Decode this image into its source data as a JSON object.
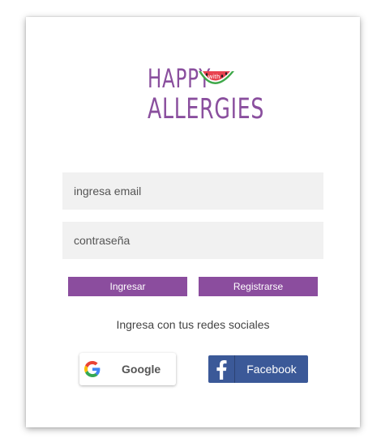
{
  "logo": {
    "line1": "HAPPY",
    "badge": "with",
    "line2": "ALLERGIES",
    "brand_color": "#8a4f9e"
  },
  "form": {
    "email_placeholder": "ingresa email",
    "password_placeholder": "contraseña",
    "login_label": "Ingresar",
    "register_label": "Registrarse",
    "button_color": "#8b4d9e",
    "field_bg": "#f1f1f1"
  },
  "social": {
    "caption": "Ingresa con tus redes sociales",
    "google_label": "Google",
    "google_icon": "google-g-icon",
    "facebook_label": "Facebook",
    "facebook_icon": "facebook-f-icon",
    "facebook_color": "#3b5998"
  }
}
